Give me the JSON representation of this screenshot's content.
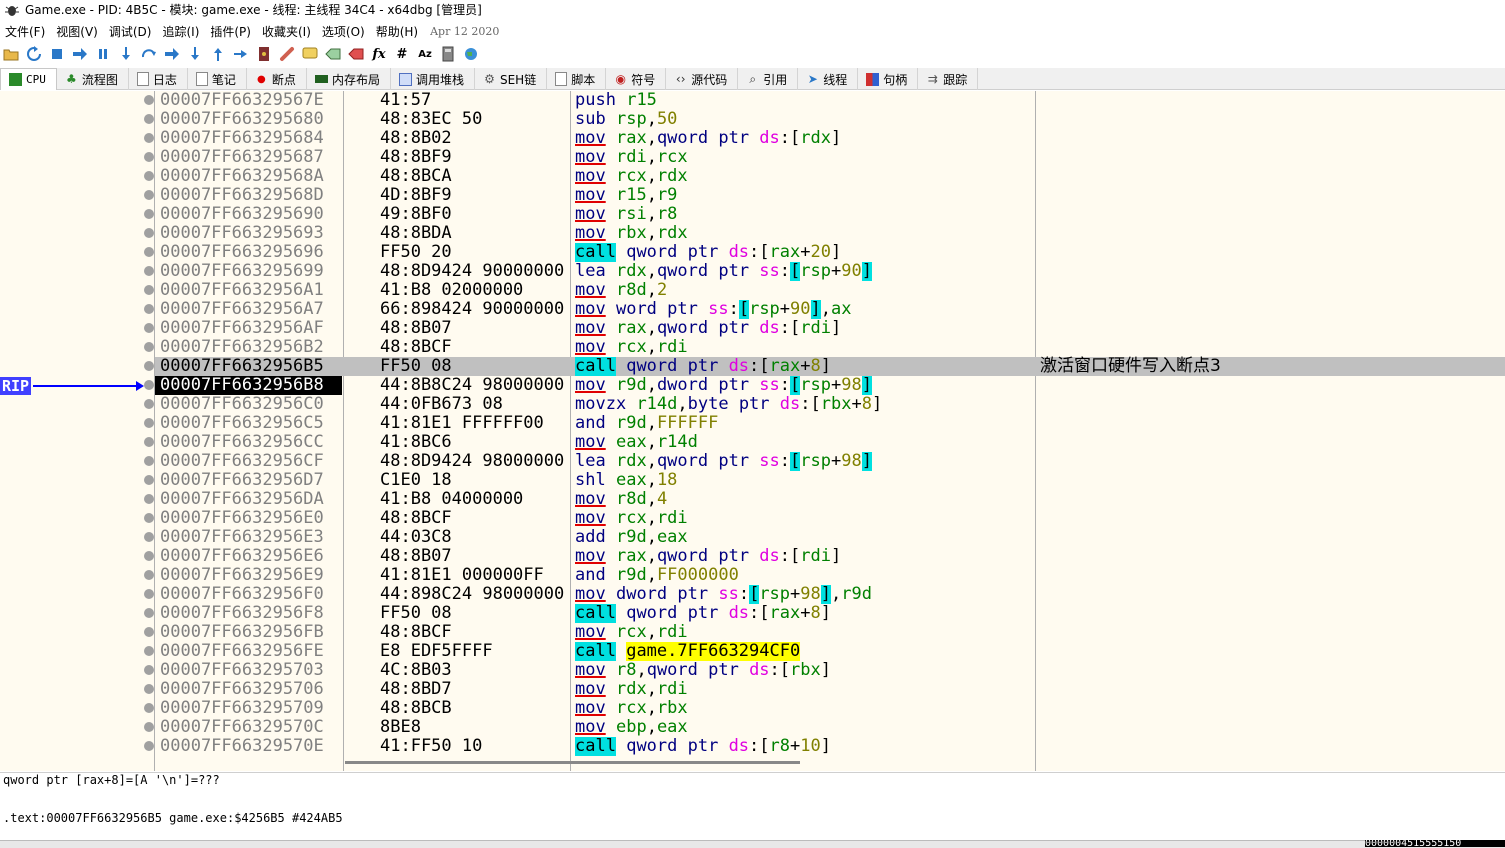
{
  "title": "Game.exe - PID: 4B5C - 模块: game.exe - 线程: 主线程 34C4 - x64dbg [管理员]",
  "menu": [
    "文件(F)",
    "视图(V)",
    "调试(D)",
    "追踪(I)",
    "插件(P)",
    "收藏夹(I)",
    "选项(O)",
    "帮助(H)"
  ],
  "menu_date": "Apr 12 2020",
  "toolbar_labels": {
    "fx": "fx",
    "hash": "#",
    "az": "Az"
  },
  "tabs": [
    "CPU",
    "流程图",
    "日志",
    "笔记",
    "断点",
    "内存布局",
    "调用堆栈",
    "SEH链",
    "脚本",
    "符号",
    "源代码",
    "引用",
    "线程",
    "句柄",
    "跟踪"
  ],
  "rip_label": "RIP",
  "rows": [
    {
      "addr": "00007FF66329567E",
      "bytes": "41:57",
      "dis": [
        [
          "mn",
          "push"
        ],
        [
          "t",
          " "
        ],
        [
          "reg",
          "r15"
        ]
      ]
    },
    {
      "addr": "00007FF663295680",
      "bytes": "48:83EC 50",
      "dis": [
        [
          "mn",
          "sub"
        ],
        [
          "t",
          " "
        ],
        [
          "reg",
          "rsp"
        ],
        [
          "t",
          ","
        ],
        [
          "num",
          "50"
        ]
      ]
    },
    {
      "addr": "00007FF663295684",
      "bytes": "48:8B02",
      "dis": [
        [
          "mnu",
          "mov"
        ],
        [
          "t",
          " "
        ],
        [
          "reg",
          "rax"
        ],
        [
          "t",
          ","
        ],
        [
          "kw",
          "qword ptr "
        ],
        [
          "seg",
          "ds"
        ],
        [
          "t",
          ":["
        ],
        [
          "reg",
          "rdx"
        ],
        [
          "t",
          "]"
        ]
      ]
    },
    {
      "addr": "00007FF663295687",
      "bytes": "48:8BF9",
      "dis": [
        [
          "mnu",
          "mov"
        ],
        [
          "t",
          " "
        ],
        [
          "reg",
          "rdi"
        ],
        [
          "t",
          ","
        ],
        [
          "reg",
          "rcx"
        ]
      ]
    },
    {
      "addr": "00007FF66329568A",
      "bytes": "48:8BCA",
      "dis": [
        [
          "mnu",
          "mov"
        ],
        [
          "t",
          " "
        ],
        [
          "reg",
          "rcx"
        ],
        [
          "t",
          ","
        ],
        [
          "reg",
          "rdx"
        ]
      ]
    },
    {
      "addr": "00007FF66329568D",
      "bytes": "4D:8BF9",
      "dis": [
        [
          "mnu",
          "mov"
        ],
        [
          "t",
          " "
        ],
        [
          "reg",
          "r15"
        ],
        [
          "t",
          ","
        ],
        [
          "reg",
          "r9"
        ]
      ]
    },
    {
      "addr": "00007FF663295690",
      "bytes": "49:8BF0",
      "dis": [
        [
          "mnu",
          "mov"
        ],
        [
          "t",
          " "
        ],
        [
          "reg",
          "rsi"
        ],
        [
          "t",
          ","
        ],
        [
          "reg",
          "r8"
        ]
      ]
    },
    {
      "addr": "00007FF663295693",
      "bytes": "48:8BDA",
      "dis": [
        [
          "mnu",
          "mov"
        ],
        [
          "t",
          " "
        ],
        [
          "reg",
          "rbx"
        ],
        [
          "t",
          ","
        ],
        [
          "reg",
          "rdx"
        ]
      ]
    },
    {
      "addr": "00007FF663295696",
      "bytes": "FF50 20",
      "dis": [
        [
          "call",
          "call"
        ],
        [
          "t",
          " "
        ],
        [
          "kw",
          "qword ptr "
        ],
        [
          "seg",
          "ds"
        ],
        [
          "t",
          ":["
        ],
        [
          "reg",
          "rax"
        ],
        [
          "t",
          "+"
        ],
        [
          "num",
          "20"
        ],
        [
          "t",
          "]"
        ]
      ]
    },
    {
      "addr": "00007FF663295699",
      "bytes": "48:8D9424 90000000",
      "dis": [
        [
          "mn",
          "lea"
        ],
        [
          "t",
          " "
        ],
        [
          "reg",
          "rdx"
        ],
        [
          "t",
          ","
        ],
        [
          "kw",
          "qword ptr "
        ],
        [
          "seg",
          "ss"
        ],
        [
          "t",
          ":"
        ],
        [
          "hb",
          "["
        ],
        [
          "reg",
          "rsp"
        ],
        [
          "t",
          "+"
        ],
        [
          "num",
          "90"
        ],
        [
          "hb",
          "]"
        ]
      ]
    },
    {
      "addr": "00007FF6632956A1",
      "bytes": "41:B8 02000000",
      "dis": [
        [
          "mnu",
          "mov"
        ],
        [
          "t",
          " "
        ],
        [
          "reg",
          "r8d"
        ],
        [
          "t",
          ","
        ],
        [
          "num",
          "2"
        ]
      ]
    },
    {
      "addr": "00007FF6632956A7",
      "bytes": "66:898424 90000000",
      "dis": [
        [
          "mnu",
          "mov"
        ],
        [
          "t",
          " "
        ],
        [
          "kw",
          "word ptr "
        ],
        [
          "seg",
          "ss"
        ],
        [
          "t",
          ":"
        ],
        [
          "hb",
          "["
        ],
        [
          "reg",
          "rsp"
        ],
        [
          "t",
          "+"
        ],
        [
          "num",
          "90"
        ],
        [
          "hb",
          "]"
        ],
        [
          "t",
          ","
        ],
        [
          "reg",
          "ax"
        ]
      ]
    },
    {
      "addr": "00007FF6632956AF",
      "bytes": "48:8B07",
      "dis": [
        [
          "mnu",
          "mov"
        ],
        [
          "t",
          " "
        ],
        [
          "reg",
          "rax"
        ],
        [
          "t",
          ","
        ],
        [
          "kw",
          "qword ptr "
        ],
        [
          "seg",
          "ds"
        ],
        [
          "t",
          ":["
        ],
        [
          "reg",
          "rdi"
        ],
        [
          "t",
          "]"
        ]
      ]
    },
    {
      "addr": "00007FF6632956B2",
      "bytes": "48:8BCF",
      "dis": [
        [
          "mnu",
          "mov"
        ],
        [
          "t",
          " "
        ],
        [
          "reg",
          "rcx"
        ],
        [
          "t",
          ","
        ],
        [
          "reg",
          "rdi"
        ]
      ]
    },
    {
      "addr": "00007FF6632956B5",
      "bytes": "FF50 08",
      "sel": true,
      "comment": "激活窗口硬件写入断点3",
      "dis": [
        [
          "call",
          "call"
        ],
        [
          "t",
          " "
        ],
        [
          "kw",
          "qword ptr "
        ],
        [
          "seg",
          "ds"
        ],
        [
          "t",
          ":["
        ],
        [
          "reg",
          "rax"
        ],
        [
          "t",
          "+"
        ],
        [
          "num",
          "8"
        ],
        [
          "t",
          "]"
        ]
      ]
    },
    {
      "addr": "00007FF6632956B8",
      "bytes": "44:8B8C24 98000000",
      "cur": true,
      "dis": [
        [
          "mnu",
          "mov"
        ],
        [
          "t",
          " "
        ],
        [
          "reg",
          "r9d"
        ],
        [
          "t",
          ","
        ],
        [
          "kw",
          "dword ptr "
        ],
        [
          "seg",
          "ss"
        ],
        [
          "t",
          ":"
        ],
        [
          "hb",
          "["
        ],
        [
          "reg",
          "rsp"
        ],
        [
          "t",
          "+"
        ],
        [
          "num",
          "98"
        ],
        [
          "hb",
          "]"
        ]
      ]
    },
    {
      "addr": "00007FF6632956C0",
      "bytes": "44:0FB673 08",
      "dis": [
        [
          "mn",
          "movzx"
        ],
        [
          "t",
          " "
        ],
        [
          "reg",
          "r14d"
        ],
        [
          "t",
          ","
        ],
        [
          "kw",
          "byte ptr "
        ],
        [
          "seg",
          "ds"
        ],
        [
          "t",
          ":["
        ],
        [
          "reg",
          "rbx"
        ],
        [
          "t",
          "+"
        ],
        [
          "num",
          "8"
        ],
        [
          "t",
          "]"
        ]
      ]
    },
    {
      "addr": "00007FF6632956C5",
      "bytes": "41:81E1 FFFFFF00",
      "dis": [
        [
          "mn",
          "and"
        ],
        [
          "t",
          " "
        ],
        [
          "reg",
          "r9d"
        ],
        [
          "t",
          ","
        ],
        [
          "num",
          "FFFFFF"
        ]
      ]
    },
    {
      "addr": "00007FF6632956CC",
      "bytes": "41:8BC6",
      "dis": [
        [
          "mnu",
          "mov"
        ],
        [
          "t",
          " "
        ],
        [
          "reg",
          "eax"
        ],
        [
          "t",
          ","
        ],
        [
          "reg",
          "r14d"
        ]
      ]
    },
    {
      "addr": "00007FF6632956CF",
      "bytes": "48:8D9424 98000000",
      "dis": [
        [
          "mn",
          "lea"
        ],
        [
          "t",
          " "
        ],
        [
          "reg",
          "rdx"
        ],
        [
          "t",
          ","
        ],
        [
          "kw",
          "qword ptr "
        ],
        [
          "seg",
          "ss"
        ],
        [
          "t",
          ":"
        ],
        [
          "hb",
          "["
        ],
        [
          "reg",
          "rsp"
        ],
        [
          "t",
          "+"
        ],
        [
          "num",
          "98"
        ],
        [
          "hb",
          "]"
        ]
      ]
    },
    {
      "addr": "00007FF6632956D7",
      "bytes": "C1E0 18",
      "dis": [
        [
          "mn",
          "shl"
        ],
        [
          "t",
          " "
        ],
        [
          "reg",
          "eax"
        ],
        [
          "t",
          ","
        ],
        [
          "num",
          "18"
        ]
      ]
    },
    {
      "addr": "00007FF6632956DA",
      "bytes": "41:B8 04000000",
      "dis": [
        [
          "mnu",
          "mov"
        ],
        [
          "t",
          " "
        ],
        [
          "reg",
          "r8d"
        ],
        [
          "t",
          ","
        ],
        [
          "num",
          "4"
        ]
      ]
    },
    {
      "addr": "00007FF6632956E0",
      "bytes": "48:8BCF",
      "dis": [
        [
          "mnu",
          "mov"
        ],
        [
          "t",
          " "
        ],
        [
          "reg",
          "rcx"
        ],
        [
          "t",
          ","
        ],
        [
          "reg",
          "rdi"
        ]
      ]
    },
    {
      "addr": "00007FF6632956E3",
      "bytes": "44:03C8",
      "dis": [
        [
          "mn",
          "add"
        ],
        [
          "t",
          " "
        ],
        [
          "reg",
          "r9d"
        ],
        [
          "t",
          ","
        ],
        [
          "reg",
          "eax"
        ]
      ]
    },
    {
      "addr": "00007FF6632956E6",
      "bytes": "48:8B07",
      "dis": [
        [
          "mnu",
          "mov"
        ],
        [
          "t",
          " "
        ],
        [
          "reg",
          "rax"
        ],
        [
          "t",
          ","
        ],
        [
          "kw",
          "qword ptr "
        ],
        [
          "seg",
          "ds"
        ],
        [
          "t",
          ":["
        ],
        [
          "reg",
          "rdi"
        ],
        [
          "t",
          "]"
        ]
      ]
    },
    {
      "addr": "00007FF6632956E9",
      "bytes": "41:81E1 000000FF",
      "dis": [
        [
          "mn",
          "and"
        ],
        [
          "t",
          " "
        ],
        [
          "reg",
          "r9d"
        ],
        [
          "t",
          ","
        ],
        [
          "num",
          "FF000000"
        ]
      ]
    },
    {
      "addr": "00007FF6632956F0",
      "bytes": "44:898C24 98000000",
      "dis": [
        [
          "mnu",
          "mov"
        ],
        [
          "t",
          " "
        ],
        [
          "kw",
          "dword ptr "
        ],
        [
          "seg",
          "ss"
        ],
        [
          "t",
          ":"
        ],
        [
          "hb",
          "["
        ],
        [
          "reg",
          "rsp"
        ],
        [
          "t",
          "+"
        ],
        [
          "num",
          "98"
        ],
        [
          "hb",
          "]"
        ],
        [
          "t",
          ","
        ],
        [
          "reg",
          "r9d"
        ]
      ]
    },
    {
      "addr": "00007FF6632956F8",
      "bytes": "FF50 08",
      "dis": [
        [
          "call",
          "call"
        ],
        [
          "t",
          " "
        ],
        [
          "kw",
          "qword ptr "
        ],
        [
          "seg",
          "ds"
        ],
        [
          "t",
          ":["
        ],
        [
          "reg",
          "rax"
        ],
        [
          "t",
          "+"
        ],
        [
          "num",
          "8"
        ],
        [
          "t",
          "]"
        ]
      ]
    },
    {
      "addr": "00007FF6632956FB",
      "bytes": "48:8BCF",
      "dis": [
        [
          "mnu",
          "mov"
        ],
        [
          "t",
          " "
        ],
        [
          "reg",
          "rcx"
        ],
        [
          "t",
          ","
        ],
        [
          "reg",
          "rdi"
        ]
      ]
    },
    {
      "addr": "00007FF6632956FE",
      "bytes": "E8 EDF5FFFF",
      "dis": [
        [
          "call",
          "call"
        ],
        [
          "t",
          " "
        ],
        [
          "addrhl",
          "game.7FF663294CF0"
        ]
      ]
    },
    {
      "addr": "00007FF663295703",
      "bytes": "4C:8B03",
      "dis": [
        [
          "mnu",
          "mov"
        ],
        [
          "t",
          " "
        ],
        [
          "reg",
          "r8"
        ],
        [
          "t",
          ","
        ],
        [
          "kw",
          "qword ptr "
        ],
        [
          "seg",
          "ds"
        ],
        [
          "t",
          ":["
        ],
        [
          "reg",
          "rbx"
        ],
        [
          "t",
          "]"
        ]
      ]
    },
    {
      "addr": "00007FF663295706",
      "bytes": "48:8BD7",
      "dis": [
        [
          "mnu",
          "mov"
        ],
        [
          "t",
          " "
        ],
        [
          "reg",
          "rdx"
        ],
        [
          "t",
          ","
        ],
        [
          "reg",
          "rdi"
        ]
      ]
    },
    {
      "addr": "00007FF663295709",
      "bytes": "48:8BCB",
      "dis": [
        [
          "mnu",
          "mov"
        ],
        [
          "t",
          " "
        ],
        [
          "reg",
          "rcx"
        ],
        [
          "t",
          ","
        ],
        [
          "reg",
          "rbx"
        ]
      ]
    },
    {
      "addr": "00007FF66329570C",
      "bytes": "8BE8",
      "dis": [
        [
          "mnu",
          "mov"
        ],
        [
          "t",
          " "
        ],
        [
          "reg",
          "ebp"
        ],
        [
          "t",
          ","
        ],
        [
          "reg",
          "eax"
        ]
      ]
    },
    {
      "addr": "00007FF66329570E",
      "bytes": "41:FF50 10",
      "dis": [
        [
          "call",
          "call"
        ],
        [
          "t",
          " "
        ],
        [
          "kw",
          "qword ptr "
        ],
        [
          "seg",
          "ds"
        ],
        [
          "t",
          ":["
        ],
        [
          "reg",
          "r8"
        ],
        [
          "t",
          "+"
        ],
        [
          "num",
          "10"
        ],
        [
          "t",
          "]"
        ]
      ]
    }
  ],
  "status_line1": "qword ptr [rax+8]=[A '\\n']=???",
  "status_line2": ".text:00007FF6632956B5 game.exe:$4256B5 #424AB5",
  "bottom_value": "0000004515555150"
}
